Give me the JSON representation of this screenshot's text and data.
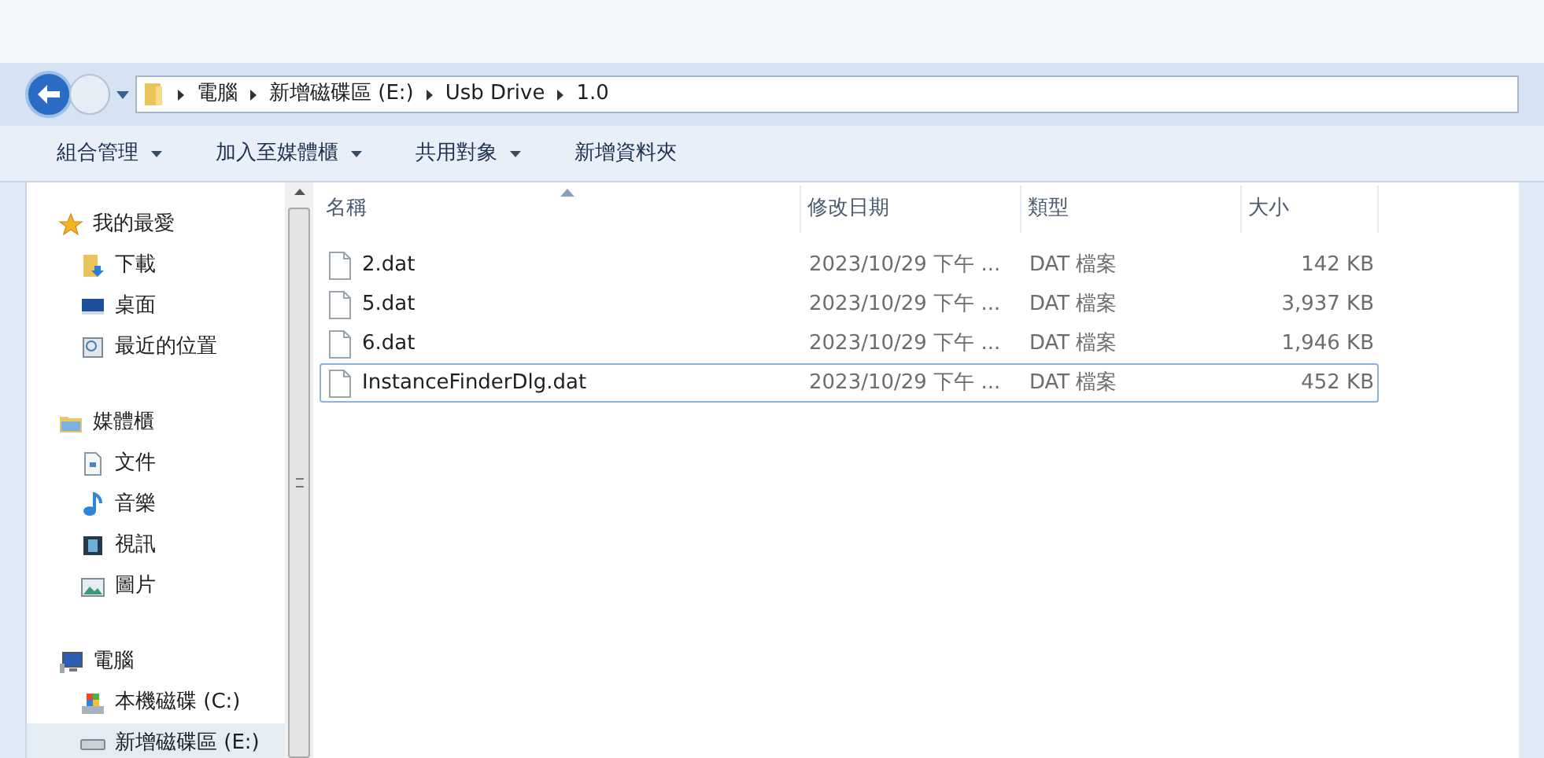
{
  "breadcrumb": [
    "電腦",
    "新增磁碟區 (E:)",
    "Usb Drive",
    "1.0"
  ],
  "toolbar": [
    {
      "label": "組合管理",
      "dropdown": true
    },
    {
      "label": "加入至媒體櫃",
      "dropdown": true
    },
    {
      "label": "共用對象",
      "dropdown": true
    },
    {
      "label": "新增資料夾",
      "dropdown": false
    }
  ],
  "sidebar": {
    "groups": [
      {
        "label": "我的最愛",
        "kind": "star",
        "children": [
          {
            "label": "下載",
            "kind": "download",
            "selected": false
          },
          {
            "label": "桌面",
            "kind": "desktop",
            "selected": false
          },
          {
            "label": "最近的位置",
            "kind": "recent",
            "selected": false
          }
        ]
      },
      {
        "label": "媒體櫃",
        "kind": "library",
        "children": [
          {
            "label": "文件",
            "kind": "document",
            "selected": false
          },
          {
            "label": "音樂",
            "kind": "music",
            "selected": false
          },
          {
            "label": "視訊",
            "kind": "video",
            "selected": false
          },
          {
            "label": "圖片",
            "kind": "image",
            "selected": false
          }
        ]
      },
      {
        "label": "電腦",
        "kind": "computer",
        "children": [
          {
            "label": "本機磁碟 (C:)",
            "kind": "system-drive",
            "selected": false
          },
          {
            "label": "新增磁碟區 (E:)",
            "kind": "drive",
            "selected": true
          }
        ]
      }
    ]
  },
  "table": {
    "columns": [
      {
        "label": "名稱",
        "sorted": true
      },
      {
        "label": "修改日期",
        "sorted": false
      },
      {
        "label": "類型",
        "sorted": false
      },
      {
        "label": "大小",
        "sorted": false
      }
    ],
    "rows": [
      {
        "name": "2.dat",
        "modified": "2023/10/29 下午 ...",
        "type": "DAT 檔案",
        "size": "142 KB",
        "focused": false
      },
      {
        "name": "5.dat",
        "modified": "2023/10/29 下午 ...",
        "type": "DAT 檔案",
        "size": "3,937 KB",
        "focused": false
      },
      {
        "name": "6.dat",
        "modified": "2023/10/29 下午 ...",
        "type": "DAT 檔案",
        "size": "1,946 KB",
        "focused": false
      },
      {
        "name": "InstanceFinderDlg.dat",
        "modified": "2023/10/29 下午 ...",
        "type": "DAT 檔案",
        "size": "452 KB",
        "focused": true
      }
    ]
  }
}
